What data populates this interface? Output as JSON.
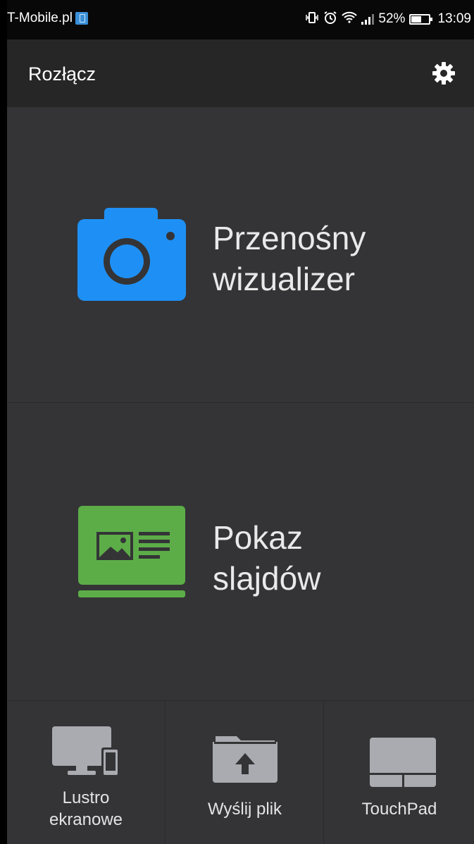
{
  "status_bar": {
    "carrier": "T-Mobile.pl",
    "battery_percent": "52%",
    "time": "13:09",
    "icons": [
      "vibrate-icon",
      "alarm-icon",
      "wifi-icon",
      "signal-icon",
      "battery-icon"
    ]
  },
  "toolbar": {
    "title": "Rozłącz",
    "settings_icon": "gear-icon"
  },
  "tiles": [
    {
      "line1": "Przenośny",
      "line2": "wizualizer",
      "icon": "camera-icon",
      "color": "#1e90f5"
    },
    {
      "line1": "Pokaz",
      "line2": "slajdów",
      "icon": "slideshow-icon",
      "color": "#5cad48"
    }
  ],
  "bottom_tabs": [
    {
      "line1": "Lustro",
      "line2": "ekranowe",
      "icon": "screen-mirror-icon"
    },
    {
      "line1": "Wyślij plik",
      "line2": "",
      "icon": "upload-folder-icon"
    },
    {
      "line1": "TouchPad",
      "line2": "",
      "icon": "touchpad-icon"
    }
  ],
  "colors": {
    "background": "#343436",
    "toolbar": "#262627",
    "status_bar": "#080808",
    "camera_blue": "#1e90f5",
    "slides_green": "#5cad48",
    "icon_gray": "#a9abb0"
  }
}
